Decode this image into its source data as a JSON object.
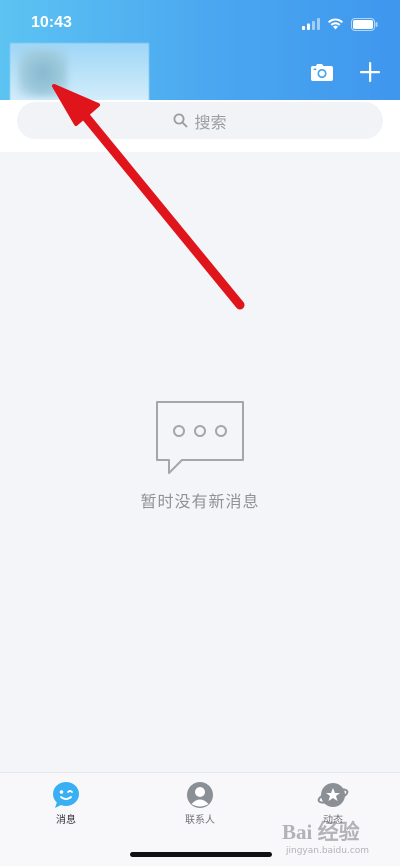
{
  "status_bar": {
    "time": "10:43"
  },
  "search": {
    "placeholder": "搜索"
  },
  "empty_state": {
    "message": "暂时没有新消息"
  },
  "tabs": [
    {
      "label": "消息",
      "icon": "messages-tab-icon",
      "active": true
    },
    {
      "label": "联系人",
      "icon": "contacts-tab-icon",
      "active": false
    },
    {
      "label": "动态",
      "icon": "dynamics-tab-icon",
      "active": false
    }
  ],
  "watermark": {
    "main": "Bai 经验",
    "sub": "jingyan.baidu.com"
  },
  "colors": {
    "header_start": "#5cc3f2",
    "header_end": "#3f97ee",
    "arrow": "#e0141b",
    "background": "#f4f5f9"
  }
}
